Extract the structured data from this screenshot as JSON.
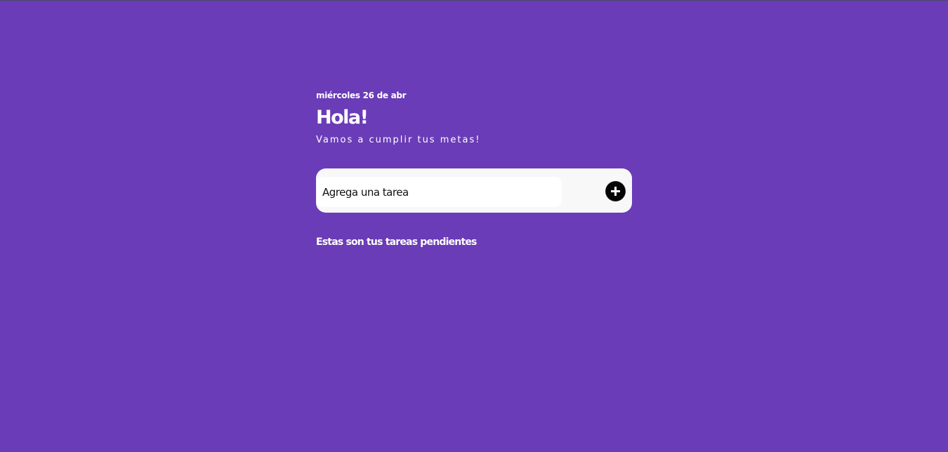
{
  "header": {
    "date": "miércoles 26 de abr",
    "greeting": "Hola!",
    "subtitle": "Vamos a cumplir tus metas!"
  },
  "task_form": {
    "input_placeholder": "Agrega una tarea",
    "input_value": "",
    "add_icon": "plus-circle-icon"
  },
  "tasks_section": {
    "title": "Estas son tus tareas pendientes",
    "items": []
  },
  "colors": {
    "background": "#6a3cb7",
    "text": "#ffffff",
    "card": "#f8f8f8",
    "button": "#050505"
  }
}
